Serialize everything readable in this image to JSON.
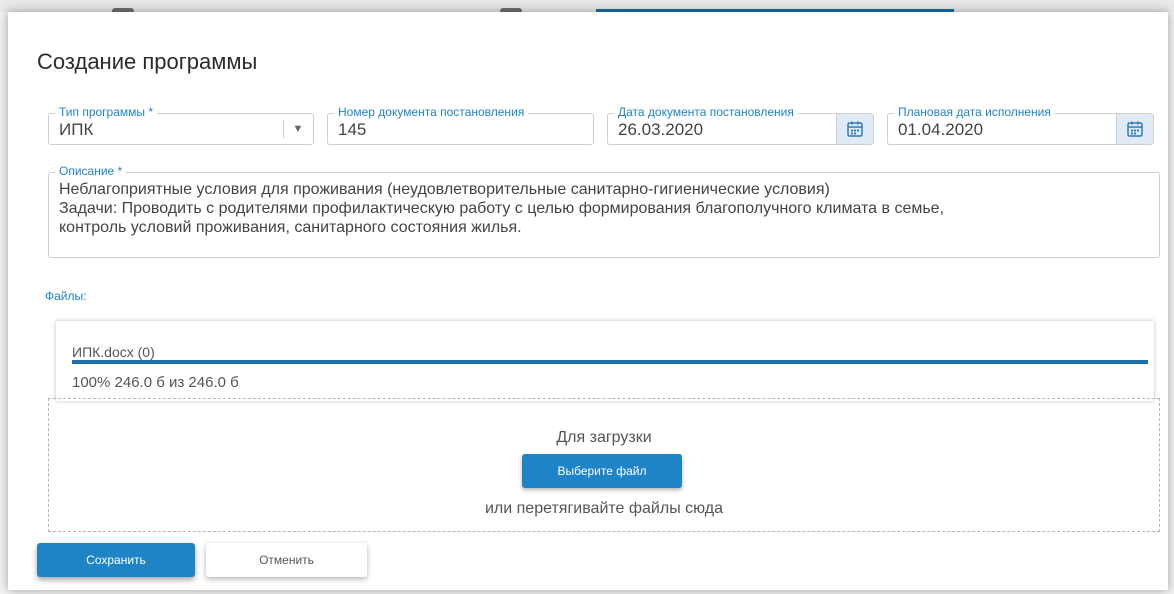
{
  "dialog": {
    "title": "Создание программы"
  },
  "form": {
    "program_type": {
      "label": "Тип программы *",
      "value": "ИПК"
    },
    "doc_number": {
      "label": "Номер документа постановления",
      "value": "145"
    },
    "doc_date": {
      "label": "Дата документа постановления",
      "value": "26.03.2020"
    },
    "planned_date": {
      "label": "Плановая дата исполнения",
      "value": "01.04.2020"
    },
    "description": {
      "label": "Описание *",
      "lines": [
        "Неблагоприятные условия для проживания (неудовлетворительные санитарно-гигиенические условия)",
        "Задачи: Проводить с родителями профилактическую работу с целью формирования  благополучного климата в семье,",
        "контроль условий проживания, санитарного состояния жилья."
      ]
    }
  },
  "files": {
    "label": "Файлы:",
    "items": [
      {
        "name": "ИПК.docx (0)",
        "progress": 100,
        "status": "100% 246.0 б из 246.0 б"
      }
    ]
  },
  "dropzone": {
    "title": "Для загрузки",
    "button_label": "Выберите файл",
    "hint": "или перетягивайте файлы сюда"
  },
  "actions": {
    "save_label": "Сохранить",
    "cancel_label": "Отменить"
  },
  "icons": {
    "dropdown": "chevron-down-icon",
    "calendar": "calendar-icon"
  },
  "colors": {
    "accent": "#1f84c6",
    "progress": "#1d6fa5",
    "label": "#1f84c6"
  }
}
